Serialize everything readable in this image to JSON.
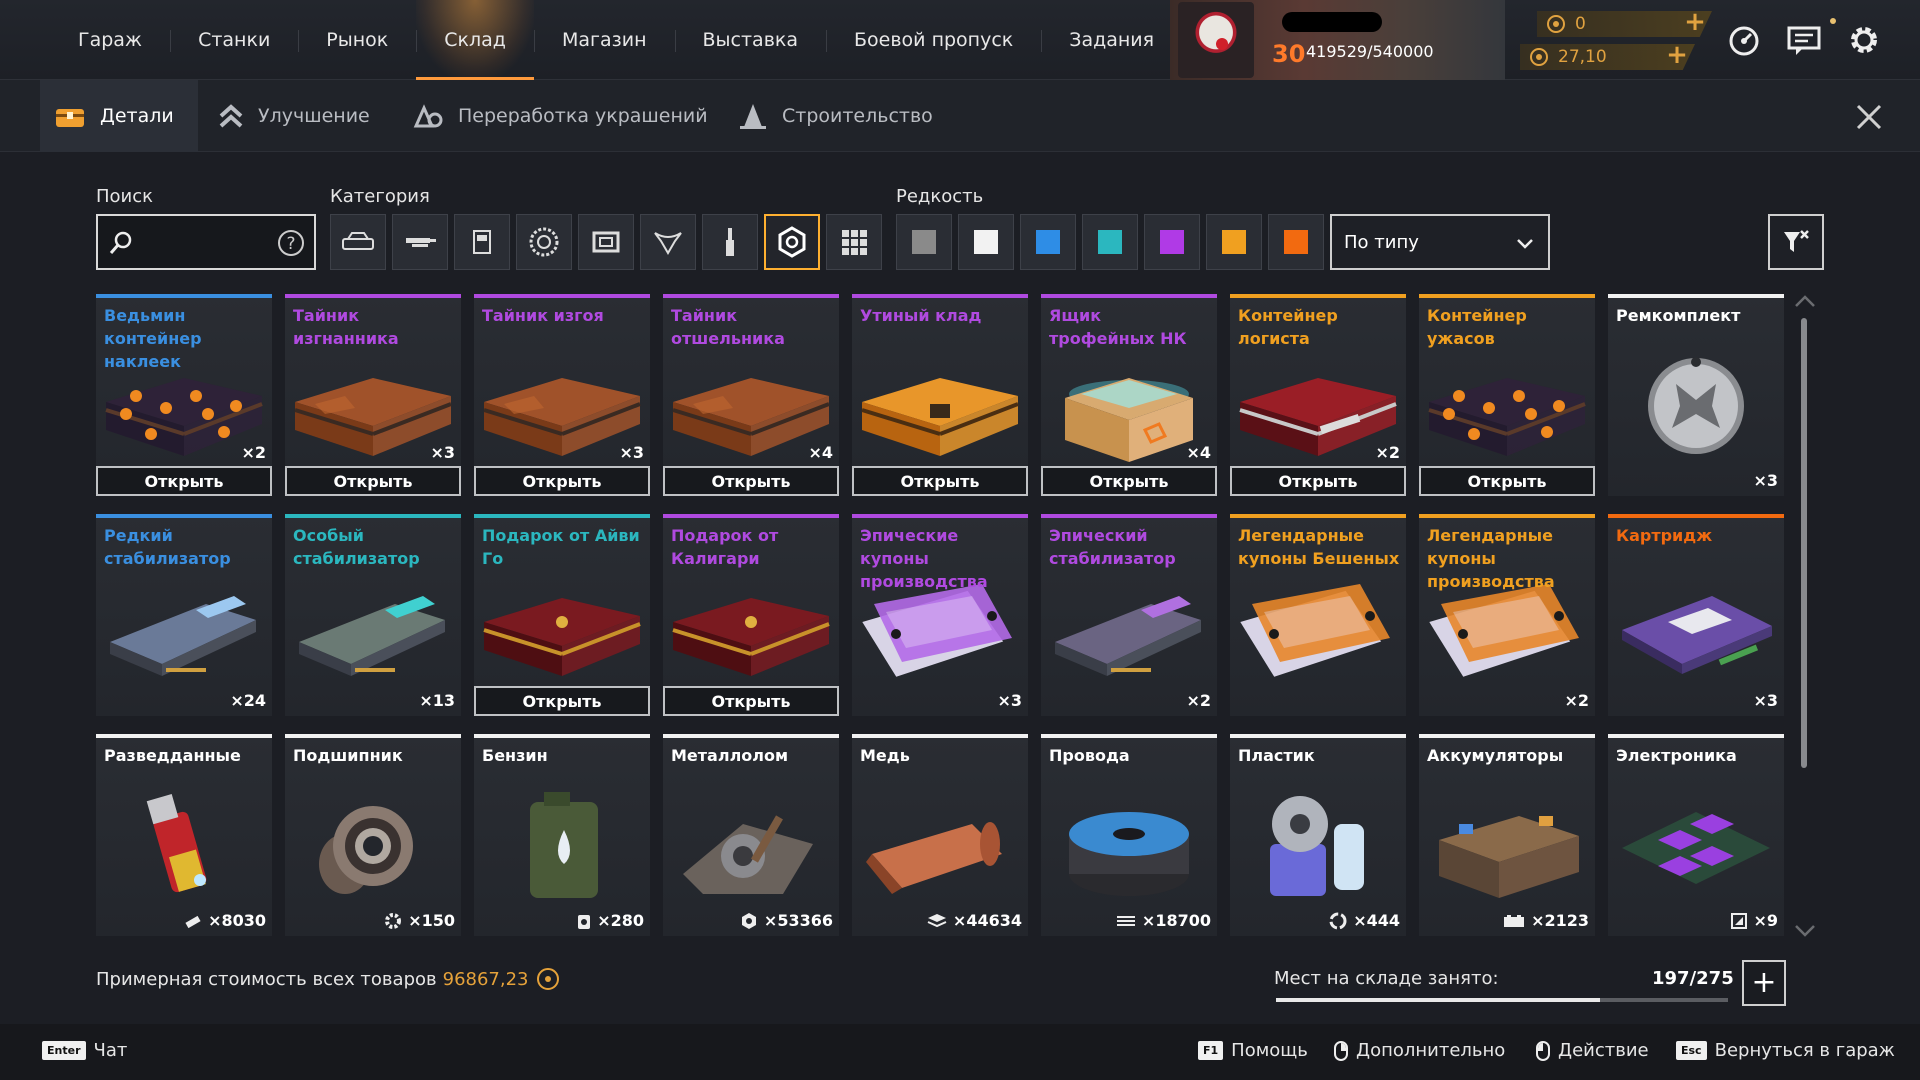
{
  "nav": {
    "items": [
      "Гараж",
      "Станки",
      "Рынок",
      "Склад",
      "Магазин",
      "Выставка",
      "Боевой пропуск",
      "Задания"
    ],
    "active_index": 3
  },
  "player": {
    "level": "30",
    "xp": "419529/540000",
    "currency_1": "0",
    "currency_2": "27,10"
  },
  "subtabs": [
    "Детали",
    "Улучшение",
    "Переработка украшений",
    "Строительство"
  ],
  "filters": {
    "search_label": "Поиск",
    "search_placeholder": "",
    "category_label": "Категория",
    "categories": [
      "car-icon",
      "weapon-icon",
      "cabin-icon",
      "wheel-icon",
      "frame-icon",
      "decor-icon",
      "paint-icon",
      "item-icon",
      "all-icon"
    ],
    "active_category": 7,
    "rarity_label": "Редкость",
    "rarity_colors": [
      "#8a8a8a",
      "#f2f2f2",
      "#2e8de6",
      "#2bb7bf",
      "#b03ae6",
      "#f0a020",
      "#f26a10"
    ],
    "sort_label": "По типу"
  },
  "open_label": "Открыть",
  "items": [
    {
      "title": "Ведьмин контейнер наклеек",
      "qty": "×2",
      "rarity": "#3a8fe0",
      "open": true,
      "art": "crate-pumpkin"
    },
    {
      "title": "Тайник изгнанника",
      "qty": "×3",
      "rarity": "#b04ae0",
      "open": true,
      "art": "crate-rust"
    },
    {
      "title": "Тайник изгоя",
      "qty": "×3",
      "rarity": "#b04ae0",
      "open": true,
      "art": "crate-rust"
    },
    {
      "title": "Тайник отшельника",
      "qty": "×4",
      "rarity": "#b04ae0",
      "open": true,
      "art": "crate-rust"
    },
    {
      "title": "Утиный клад",
      "qty": "",
      "rarity": "#b04ae0",
      "open": true,
      "art": "crate-orange"
    },
    {
      "title": "Ящик трофейных НК",
      "qty": "×4",
      "rarity": "#b04ae0",
      "open": true,
      "art": "box-glow"
    },
    {
      "title": "Контейнер логиста",
      "qty": "×2",
      "rarity": "#f0a020",
      "open": true,
      "art": "crate-red"
    },
    {
      "title": "Контейнер ужасов",
      "qty": "",
      "rarity": "#f0a020",
      "open": true,
      "art": "crate-pumpkin"
    },
    {
      "title": "Ремкомплект",
      "qty": "×3",
      "rarity": "#f2f2f2",
      "open": false,
      "art": "medal"
    },
    {
      "title": "Редкий стабилизатор",
      "qty": "×24",
      "rarity": "#3a8fe0",
      "open": false,
      "art": "stab-blue"
    },
    {
      "title": "Особый стабилизатор",
      "qty": "×13",
      "rarity": "#2bb7bf",
      "open": false,
      "art": "stab-teal"
    },
    {
      "title": "Подарок от Айви Го",
      "qty": "",
      "rarity": "#2bb7bf",
      "open": true,
      "art": "crate-darkred"
    },
    {
      "title": "Подарок от Калигари",
      "qty": "",
      "rarity": "#b04ae0",
      "open": true,
      "art": "crate-darkred"
    },
    {
      "title": "Эпические купоны производства",
      "qty": "×3",
      "rarity": "#b04ae0",
      "open": false,
      "art": "coupon-purple"
    },
    {
      "title": "Эпический стабилизатор",
      "qty": "×2",
      "rarity": "#b04ae0",
      "open": false,
      "art": "stab-purple"
    },
    {
      "title": "Легендарные купоны Бешеных",
      "qty": "",
      "rarity": "#f0a020",
      "open": false,
      "art": "coupon-orange"
    },
    {
      "title": "Легендарные купоны производства",
      "qty": "×2",
      "rarity": "#f0a020",
      "open": false,
      "art": "coupon-orange"
    },
    {
      "title": "Картридж",
      "qty": "×3",
      "rarity": "#f26a10",
      "open": false,
      "art": "cartridge"
    },
    {
      "title": "Разведданные",
      "qty": "×8030",
      "rarity": "#f2f2f2",
      "open": false,
      "art": "usb",
      "icon": "intel-icon"
    },
    {
      "title": "Подшипник",
      "qty": "×150",
      "rarity": "#f2f2f2",
      "open": false,
      "art": "bearing",
      "icon": "gear-icon"
    },
    {
      "title": "Бензин",
      "qty": "×280",
      "rarity": "#f2f2f2",
      "open": false,
      "art": "canister",
      "icon": "fuel-icon"
    },
    {
      "title": "Металлолом",
      "qty": "×53366",
      "rarity": "#f2f2f2",
      "open": false,
      "art": "scrap",
      "icon": "hex-bolt-icon"
    },
    {
      "title": "Медь",
      "qty": "×44634",
      "rarity": "#f2f2f2",
      "open": false,
      "art": "copper",
      "icon": "layers-icon"
    },
    {
      "title": "Провода",
      "qty": "×18700",
      "rarity": "#f2f2f2",
      "open": false,
      "art": "wire",
      "icon": "wire-icon"
    },
    {
      "title": "Пластик",
      "qty": "×444",
      "rarity": "#f2f2f2",
      "open": false,
      "art": "plastic",
      "icon": "recycle-icon"
    },
    {
      "title": "Аккумуляторы",
      "qty": "×2123",
      "rarity": "#f2f2f2",
      "open": false,
      "art": "battery",
      "icon": "battery-icon"
    },
    {
      "title": "Электроника",
      "qty": "×9",
      "rarity": "#f2f2f2",
      "open": false,
      "art": "chip",
      "icon": "chip-icon"
    }
  ],
  "footer": {
    "estimate_label": "Примерная стоимость всех товаров",
    "estimate_value": "96867,23",
    "storage_label": "Мест на складе занято:",
    "storage_count": "197/275",
    "storage_fraction": 0.716,
    "hints": [
      {
        "key": "Enter",
        "label": "Чат"
      },
      {
        "key": "F1",
        "label": "Помощь"
      },
      {
        "key": "mouse-right",
        "label": "Дополнительно"
      },
      {
        "key": "mouse-left",
        "label": "Действие"
      },
      {
        "key": "Esc",
        "label": "Вернуться в гараж"
      }
    ]
  }
}
